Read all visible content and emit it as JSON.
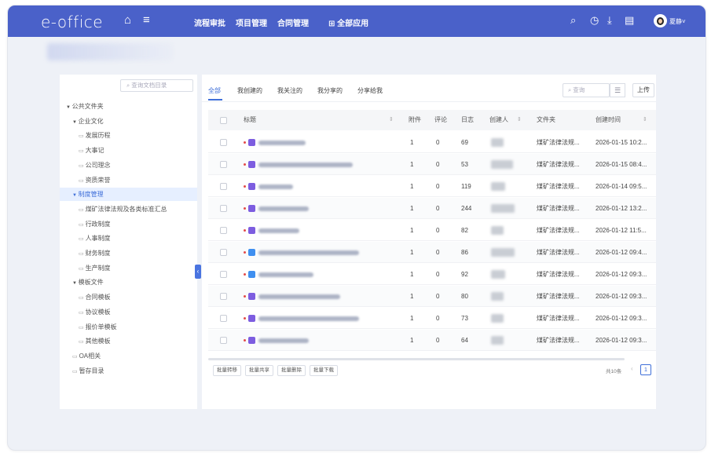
{
  "app": {
    "logo": "e-office"
  },
  "topbar": {
    "nav": [
      "流程审批",
      "项目管理",
      "合同管理"
    ],
    "all_apps": "全部应用",
    "username": "夏静",
    "caret": "˅"
  },
  "tree": {
    "search_placeholder": "查询文档目录",
    "nodes": [
      {
        "label": "公共文件夹",
        "level": 0,
        "arrow": "▼",
        "selected": false
      },
      {
        "label": "企业文化",
        "level": 1,
        "arrow": "▼",
        "selected": false
      },
      {
        "label": "发展历程",
        "level": 2,
        "arrow": "",
        "selected": false
      },
      {
        "label": "大事记",
        "level": 2,
        "arrow": "",
        "selected": false
      },
      {
        "label": "公司理念",
        "level": 2,
        "arrow": "",
        "selected": false
      },
      {
        "label": "资质荣誉",
        "level": 2,
        "arrow": "",
        "selected": false
      },
      {
        "label": "制度管理",
        "level": 1,
        "arrow": "▼",
        "selected": true
      },
      {
        "label": "煤矿法律法规及各类标准汇总",
        "level": 2,
        "arrow": "",
        "selected": false
      },
      {
        "label": "行政制度",
        "level": 2,
        "arrow": "",
        "selected": false
      },
      {
        "label": "人事制度",
        "level": 2,
        "arrow": "",
        "selected": false
      },
      {
        "label": "财务制度",
        "level": 2,
        "arrow": "",
        "selected": false
      },
      {
        "label": "生产制度",
        "level": 2,
        "arrow": "",
        "selected": false
      },
      {
        "label": "模板文件",
        "level": 1,
        "arrow": "▼",
        "selected": false
      },
      {
        "label": "合同模板",
        "level": 2,
        "arrow": "",
        "selected": false
      },
      {
        "label": "协议模板",
        "level": 2,
        "arrow": "",
        "selected": false
      },
      {
        "label": "报价单模板",
        "level": 2,
        "arrow": "",
        "selected": false
      },
      {
        "label": "其他模板",
        "level": 2,
        "arrow": "",
        "selected": false
      },
      {
        "label": "OA相关",
        "level": 1,
        "arrow": "",
        "selected": false
      },
      {
        "label": "暂存目录",
        "level": 1,
        "arrow": "",
        "selected": false
      }
    ]
  },
  "tabs": [
    {
      "label": "全部",
      "active": true
    },
    {
      "label": "我创建的",
      "active": false
    },
    {
      "label": "我关注的",
      "active": false
    },
    {
      "label": "我分享的",
      "active": false
    },
    {
      "label": "分享给我",
      "active": false
    }
  ],
  "toolbar": {
    "search_placeholder": "查询",
    "filter_icon": "☰",
    "upload_label": "上传"
  },
  "table": {
    "columns": [
      "标题",
      "附件",
      "评论",
      "日志",
      "创建人",
      "文件夹",
      "创建时间"
    ],
    "rows": [
      {
        "attach": "1",
        "comments": "0",
        "logs": "69",
        "folder": "煤矿法律法规...",
        "created": "2026-01-15 10:2..."
      },
      {
        "attach": "1",
        "comments": "0",
        "logs": "53",
        "folder": "煤矿法律法规...",
        "created": "2026-01-15 08:4..."
      },
      {
        "attach": "1",
        "comments": "0",
        "logs": "119",
        "folder": "煤矿法律法规...",
        "created": "2026-01-14 09:5..."
      },
      {
        "attach": "1",
        "comments": "0",
        "logs": "244",
        "folder": "煤矿法律法规...",
        "created": "2026-01-12 13:2..."
      },
      {
        "attach": "1",
        "comments": "0",
        "logs": "82",
        "folder": "煤矿法律法规...",
        "created": "2026-01-12 11:5..."
      },
      {
        "attach": "1",
        "comments": "0",
        "logs": "86",
        "folder": "煤矿法律法规...",
        "created": "2026-01-12 09:4..."
      },
      {
        "attach": "1",
        "comments": "0",
        "logs": "92",
        "folder": "煤矿法律法规...",
        "created": "2026-01-12 09:3..."
      },
      {
        "attach": "1",
        "comments": "0",
        "logs": "80",
        "folder": "煤矿法律法规...",
        "created": "2026-01-12 09:3..."
      },
      {
        "attach": "1",
        "comments": "0",
        "logs": "73",
        "folder": "煤矿法律法规...",
        "created": "2026-01-12 09:3..."
      },
      {
        "attach": "1",
        "comments": "0",
        "logs": "64",
        "folder": "煤矿法律法规...",
        "created": "2026-01-12 09:3..."
      }
    ]
  },
  "bulk_actions": [
    "批量转移",
    "批量共享",
    "批量删除",
    "批量下载"
  ],
  "pagination": {
    "total": "共10条",
    "prev": "‹",
    "current": "1"
  },
  "colors": {
    "topbar": "#4a61c9",
    "accent": "#3f6fd9"
  }
}
